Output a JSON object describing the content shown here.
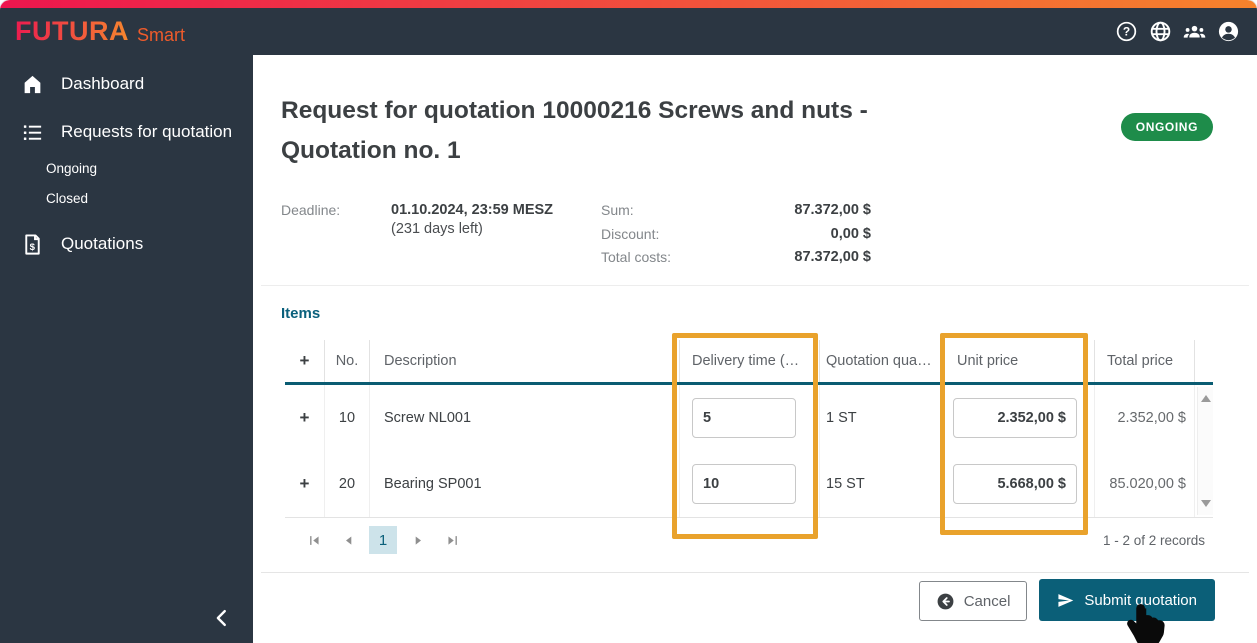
{
  "header": {
    "brand": "FUTURA",
    "brand_suffix": "Smart",
    "icons": [
      "help-icon",
      "language-icon",
      "user-groups-icon",
      "account-icon"
    ]
  },
  "sidebar": {
    "items": [
      {
        "label": "Dashboard",
        "icon": "home-icon"
      },
      {
        "label": "Requests for quotation",
        "icon": "list-icon"
      },
      {
        "label": "Ongoing"
      },
      {
        "label": "Closed"
      },
      {
        "label": "Quotations",
        "icon": "quotation-document-icon"
      }
    ]
  },
  "page": {
    "title": "Request for quotation 10000216 Screws and nuts - Quotation no. 1",
    "status_badge": "ONGOING",
    "deadline": {
      "label": "Deadline:",
      "value": "01.10.2024, 23:59 MESZ",
      "days_left": "(231 days left)"
    },
    "summary": [
      {
        "label": "Sum:",
        "value": "87.372,00 $"
      },
      {
        "label": "Discount:",
        "value": "0,00 $"
      },
      {
        "label": "Total costs:",
        "value": "87.372,00 $"
      }
    ]
  },
  "items": {
    "heading": "Items",
    "columns": [
      "+",
      "No.",
      "Description",
      "Delivery time (…",
      "Quotation qua…",
      "Unit price",
      "Total price"
    ],
    "rows": [
      {
        "expander": "+",
        "no": "10",
        "description": "Screw NL001",
        "delivery_time": "5",
        "quotation_quantity": "1 ST",
        "unit_price": "2.352,00 $",
        "total_price": "2.352,00 $"
      },
      {
        "expander": "+",
        "no": "20",
        "description": "Bearing SP001",
        "delivery_time": "10",
        "quotation_quantity": "15 ST",
        "unit_price": "5.668,00 $",
        "total_price": "85.020,00 $"
      }
    ],
    "pagination": {
      "current_page": "1",
      "records": "1 - 2 of 2 records"
    }
  },
  "actions": {
    "cancel": "Cancel",
    "submit": "Submit quotation"
  },
  "colors": {
    "accent_teal": "#0b5f78",
    "badge_green": "#1e8c4a",
    "highlight_orange": "#e9a22c",
    "gradient_start": "#ed164e",
    "gradient_end": "#f6832c",
    "sidebar_dark": "#2b3642"
  }
}
